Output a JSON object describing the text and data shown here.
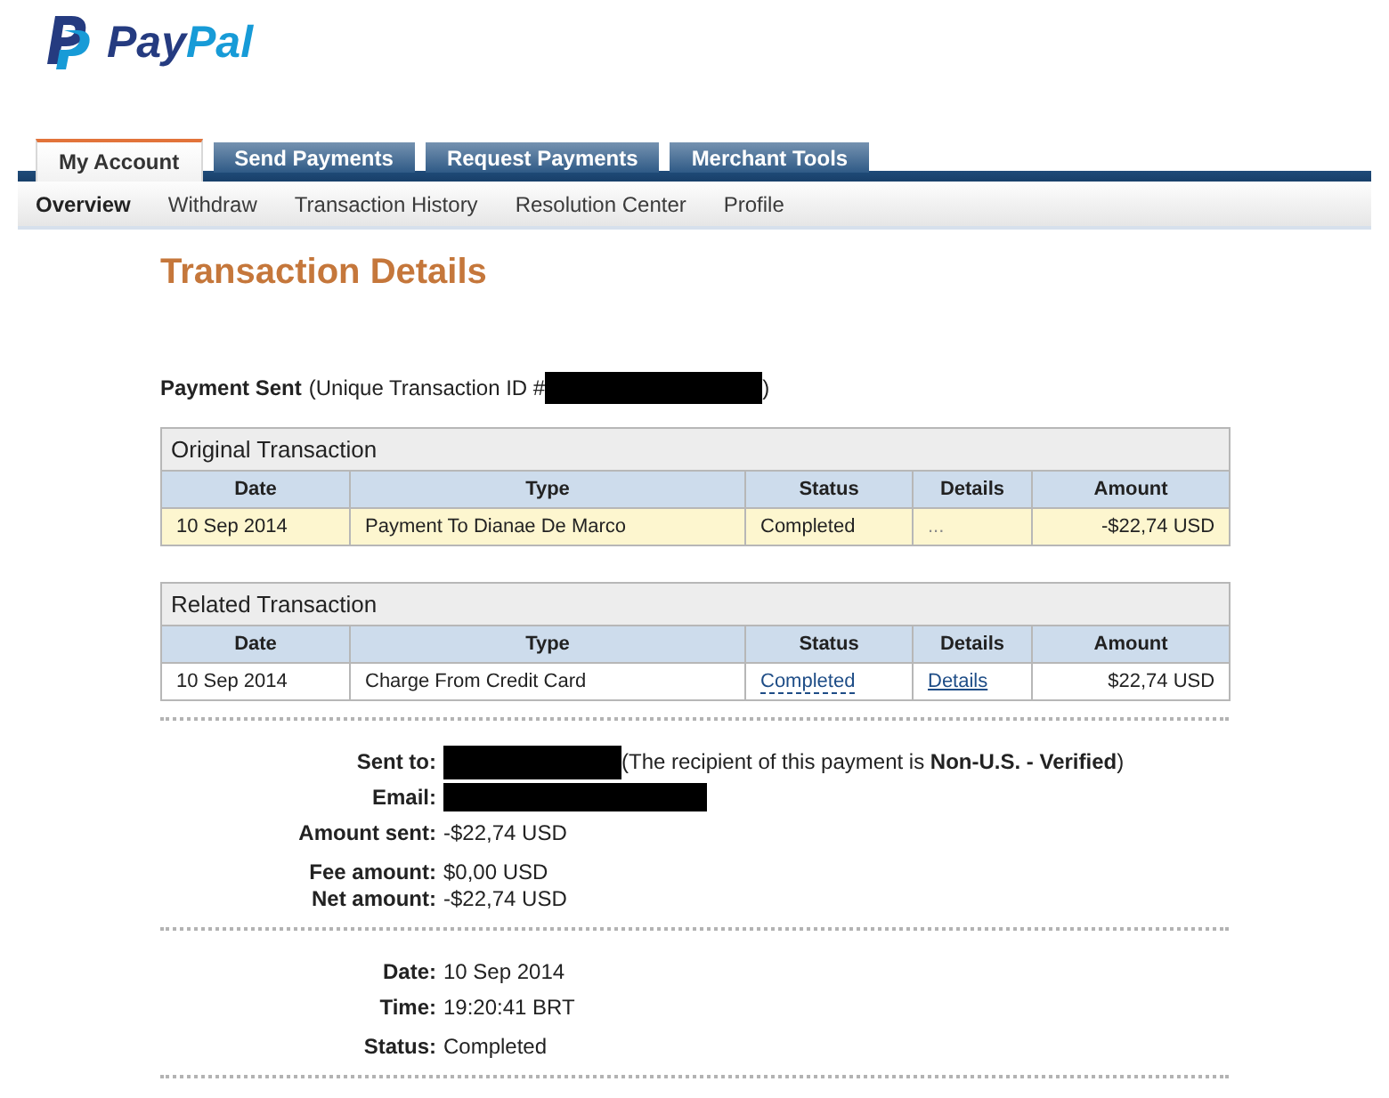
{
  "logo": {
    "wordmark": [
      "Pay",
      "Pal"
    ]
  },
  "tabs": [
    {
      "label": "My Account",
      "selected": true
    },
    {
      "label": "Send Payments",
      "selected": false
    },
    {
      "label": "Request Payments",
      "selected": false
    },
    {
      "label": "Merchant Tools",
      "selected": false
    }
  ],
  "subnav": [
    {
      "label": "Overview",
      "selected": true
    },
    {
      "label": "Withdraw",
      "selected": false
    },
    {
      "label": "Transaction History",
      "selected": false
    },
    {
      "label": "Resolution Center",
      "selected": false
    },
    {
      "label": "Profile",
      "selected": false
    }
  ],
  "title": "Transaction Details",
  "summary": {
    "heading": "Payment Sent",
    "id_label": "(Unique Transaction ID #",
    "id_redacted": true,
    "closing": ")"
  },
  "tables": [
    {
      "caption": "Original Transaction",
      "columns": [
        "Date",
        "Type",
        "Status",
        "Details",
        "Amount"
      ],
      "rows": [
        {
          "highlighted": true,
          "cells": [
            {
              "kind": "text",
              "text": "10 Sep 2014"
            },
            {
              "kind": "text",
              "text": "Payment To Dianae De Marco"
            },
            {
              "kind": "text",
              "text": "Completed"
            },
            {
              "kind": "muted",
              "text": "..."
            },
            {
              "kind": "text",
              "text": "-$22,74 USD"
            }
          ]
        }
      ]
    },
    {
      "caption": "Related Transaction",
      "columns": [
        "Date",
        "Type",
        "Status",
        "Details",
        "Amount"
      ],
      "rows": [
        {
          "highlighted": false,
          "cells": [
            {
              "kind": "text",
              "text": "10 Sep 2014"
            },
            {
              "kind": "text",
              "text": "Charge From Credit Card"
            },
            {
              "kind": "hint",
              "text": "Completed"
            },
            {
              "kind": "link",
              "text": "Details"
            },
            {
              "kind": "text",
              "text": "$22,74 USD"
            }
          ]
        }
      ]
    }
  ],
  "details_sections": [
    {
      "groups": [
        [
          {
            "label": "Sent to:",
            "redacted": true,
            "note": "(The recipient of this payment is **Non-U.S. - Verified**)"
          },
          {
            "label": "Email:",
            "redacted": true
          },
          {
            "label": "Amount sent:",
            "value": "-$22,74 USD"
          }
        ],
        [
          {
            "label": "Fee amount:",
            "value": "$0,00 USD"
          },
          {
            "label": "Net amount:",
            "value": "-$22,74 USD"
          }
        ]
      ]
    },
    {
      "groups": [
        [
          {
            "label": "Date:",
            "value": "10 Sep 2014"
          },
          {
            "label": "Time:",
            "value": "19:20:41 BRT"
          }
        ],
        [
          {
            "label": "Status:",
            "value": "Completed"
          }
        ]
      ]
    }
  ]
}
